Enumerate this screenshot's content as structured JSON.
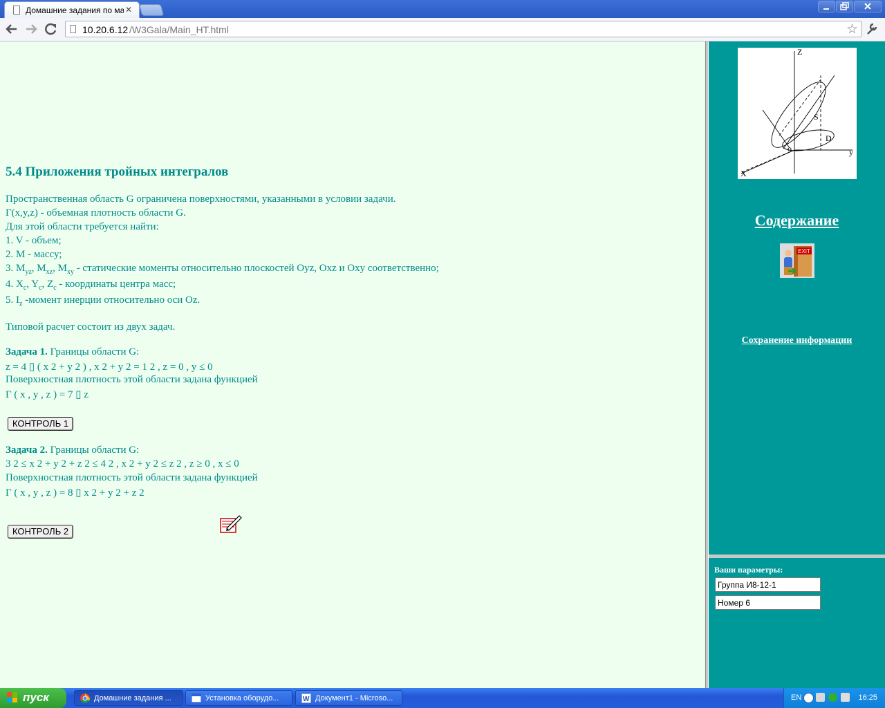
{
  "browser": {
    "tab_title": "Домашние задания по мате",
    "tab_close": "✕",
    "url_host": "10.20.6.12",
    "url_path": "/W3Gala/Main_HT.html"
  },
  "main": {
    "heading": "5.4 Приложения тройных интегралов",
    "intro": [
      "Пространственная область G ограничена поверхностями, указанными в условии задачи.",
      "Г(x,y,z) - объемная плотность области G.",
      "Для этой области требуется найти:",
      "1. V - объем;",
      "2. M - массу;"
    ],
    "item3": {
      "prefix": "3. ",
      "m": "M",
      "s1": "yz",
      "s2": "xz",
      "s3": "xy",
      "sep": ", ",
      "text": " - статические моменты относительно плоскостей Oyz, Oxz и Oxy соответственно;"
    },
    "item4": {
      "prefix": "4. ",
      "x": "X",
      "y": "Y",
      "z": "Z",
      "c": "c",
      "sep": ", ",
      "text": " - координаты центра масс;"
    },
    "item5": {
      "prefix": "5. ",
      "i": "I",
      "sub": "z",
      "text": " -момент инерции относительно оси Oz."
    },
    "summary": "Типовой расчет состоит из двух задач.",
    "task1": {
      "title": "Задача 1.",
      "bounds_label": " Границы области G:",
      "eq": "z = 4 ▯ ( x 2 + y 2 ) ,     x 2 + y 2 = 1 2 ,     z = 0 ,     y ≤ 0",
      "density_label": "Поверхностная плотность этой области задана функцией",
      "density": "Г ( x , y , z ) = 7 ▯ z",
      "button": "КОНТРОЛЬ 1"
    },
    "task2": {
      "title": "Задача 2.",
      "bounds_label": " Границы области G:",
      "eq": "3 2 ≤ x 2 + y 2 + z 2 ≤ 4 2 ,     x 2 + y 2 ≤ z 2 ,     z ≥ 0 ,     x ≤ 0",
      "density_label": "Поверхностная плотность этой области задана функцией",
      "density": "Г ( x , y , z ) = 8 ▯ x 2 + y 2 + z 2",
      "button": "КОНТРОЛЬ 2"
    }
  },
  "sidebar": {
    "contents_link": "Содержание",
    "exit_icon_text": "EXIT",
    "save_link": "Сохранение информации",
    "diagram_labels": {
      "z": "Z",
      "x": "X",
      "y": "y",
      "o": "o",
      "s": "S",
      "d": "D"
    },
    "params_label": "Ваши параметры:",
    "group_value": "Группа И8-12-1",
    "number_value": "Номер 6"
  },
  "taskbar": {
    "start_label": "пуск",
    "items": [
      {
        "label": "Домашние задания ...",
        "icon": "chrome-icon"
      },
      {
        "label": "Установка оборудо...",
        "icon": "window-icon"
      },
      {
        "label": "Документ1 - Microso...",
        "icon": "word-icon"
      }
    ],
    "lang": "EN",
    "clock": "16:25"
  },
  "colors": {
    "content_bg": "#efffef",
    "accent_teal": "#009999",
    "text_teal": "#008b8b"
  }
}
